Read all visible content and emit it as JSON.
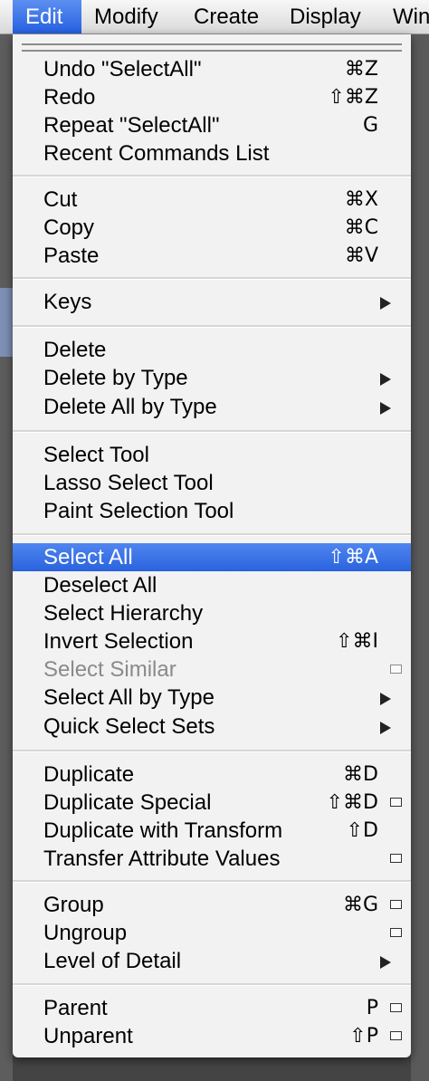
{
  "menubar": {
    "items": [
      {
        "label": "Edit"
      },
      {
        "label": "Modify"
      },
      {
        "label": "Create"
      },
      {
        "label": "Display"
      },
      {
        "label": "Win"
      }
    ]
  },
  "menu": {
    "undo": {
      "label": "Undo \"SelectAll\"",
      "shortcut": "⌘Z"
    },
    "redo": {
      "label": "Redo",
      "shortcut": "⇧⌘Z"
    },
    "repeat": {
      "label": "Repeat \"SelectAll\"",
      "shortcut": "G"
    },
    "recent_commands": {
      "label": "Recent Commands List"
    },
    "cut": {
      "label": "Cut",
      "shortcut": "⌘X"
    },
    "copy": {
      "label": "Copy",
      "shortcut": "⌘C"
    },
    "paste": {
      "label": "Paste",
      "shortcut": "⌘V"
    },
    "keys": {
      "label": "Keys"
    },
    "delete": {
      "label": "Delete"
    },
    "delete_by_type": {
      "label": "Delete by Type"
    },
    "delete_all_by_type": {
      "label": "Delete All by Type"
    },
    "select_tool": {
      "label": "Select Tool"
    },
    "lasso_select_tool": {
      "label": "Lasso Select Tool"
    },
    "paint_selection_tool": {
      "label": "Paint Selection Tool"
    },
    "select_all": {
      "label": "Select All",
      "shortcut": "⇧⌘A"
    },
    "deselect_all": {
      "label": "Deselect All"
    },
    "select_hierarchy": {
      "label": "Select Hierarchy"
    },
    "invert_selection": {
      "label": "Invert Selection",
      "shortcut": "⇧⌘I"
    },
    "select_similar": {
      "label": "Select Similar"
    },
    "select_all_by_type": {
      "label": "Select All by Type"
    },
    "quick_select_sets": {
      "label": "Quick Select Sets"
    },
    "duplicate": {
      "label": "Duplicate",
      "shortcut": "⌘D"
    },
    "duplicate_special": {
      "label": "Duplicate Special",
      "shortcut": "⇧⌘D"
    },
    "duplicate_with_transform": {
      "label": "Duplicate with Transform",
      "shortcut": "⇧D"
    },
    "transfer_attribute_values": {
      "label": "Transfer Attribute Values"
    },
    "group": {
      "label": "Group",
      "shortcut": "⌘G"
    },
    "ungroup": {
      "label": "Ungroup"
    },
    "level_of_detail": {
      "label": "Level of Detail"
    },
    "parent": {
      "label": "Parent",
      "shortcut": "P"
    },
    "unparent": {
      "label": "Unparent",
      "shortcut": "⇧P"
    }
  },
  "colors": {
    "highlight": "#2a62de",
    "menu_background": "#f2f2f2",
    "disabled_text": "#8a8a8a"
  }
}
